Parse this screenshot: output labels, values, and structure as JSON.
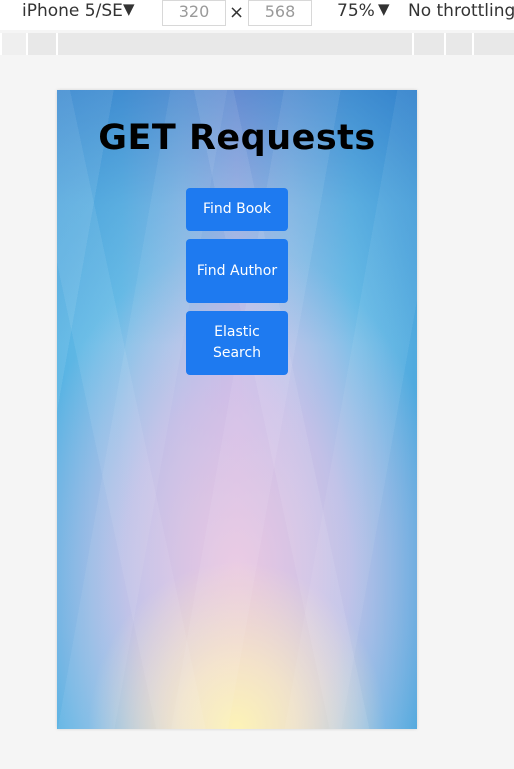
{
  "toolbar": {
    "device": "iPhone 5/SE",
    "width": "320",
    "height": "568",
    "times_symbol": "×",
    "zoom": "75%",
    "throttling": "No throttling",
    "caret": "▼"
  },
  "page": {
    "title": "GET Requests",
    "buttons": [
      {
        "label": "Find Book"
      },
      {
        "label": "Find Author"
      },
      {
        "label": "Elastic Search"
      }
    ]
  },
  "colors": {
    "button_bg": "#1e7af0",
    "button_text": "#ffffff"
  }
}
